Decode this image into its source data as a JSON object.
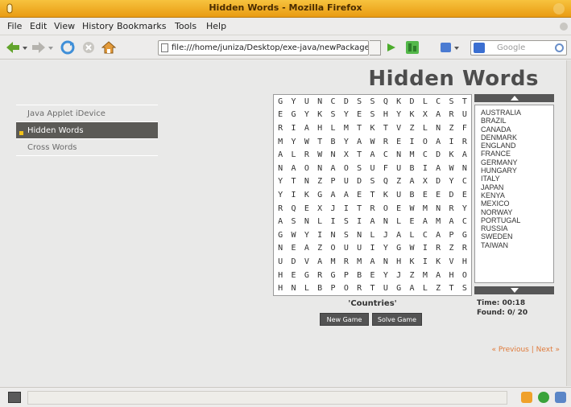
{
  "window": {
    "title": "Hidden Words - Mozilla Firefox"
  },
  "menu": [
    "File",
    "Edit",
    "View",
    "History",
    "Bookmarks",
    "Tools",
    "Help"
  ],
  "navbar": {
    "url": "file:///home/juniza/Desktop/exe-java/newPackage/hi…",
    "search_placeholder": "Google"
  },
  "app": {
    "title": "Hidden Words",
    "nav": [
      "Java Applet iDevice",
      "Hidden Words",
      "Cross Words"
    ],
    "grid": [
      [
        "G",
        "Y",
        "U",
        "N",
        "C",
        "D",
        "S",
        "S",
        "Q",
        "K",
        "D",
        "L",
        "C",
        "S",
        "T"
      ],
      [
        "E",
        "G",
        "Y",
        "K",
        "S",
        "Y",
        "E",
        "S",
        "H",
        "Y",
        "K",
        "X",
        "A",
        "R",
        "U"
      ],
      [
        "R",
        "I",
        "A",
        "H",
        "L",
        "M",
        "T",
        "K",
        "T",
        "V",
        "Z",
        "L",
        "N",
        "Z",
        "F"
      ],
      [
        "M",
        "Y",
        "W",
        "T",
        "B",
        "Y",
        "A",
        "W",
        "R",
        "E",
        "I",
        "O",
        "A",
        "I",
        "R"
      ],
      [
        "A",
        "L",
        "R",
        "W",
        "N",
        "X",
        "T",
        "A",
        "C",
        "N",
        "M",
        "C",
        "D",
        "K",
        "A"
      ],
      [
        "N",
        "A",
        "O",
        "N",
        "A",
        "O",
        "S",
        "U",
        "F",
        "U",
        "B",
        "I",
        "A",
        "W",
        "N"
      ],
      [
        "Y",
        "T",
        "N",
        "Z",
        "P",
        "U",
        "D",
        "S",
        "Q",
        "Z",
        "A",
        "X",
        "D",
        "Y",
        "C"
      ],
      [
        "Y",
        "I",
        "K",
        "G",
        "A",
        "A",
        "E",
        "T",
        "K",
        "U",
        "B",
        "E",
        "E",
        "D",
        "E"
      ],
      [
        "R",
        "Q",
        "E",
        "X",
        "J",
        "I",
        "T",
        "R",
        "O",
        "E",
        "W",
        "M",
        "N",
        "R",
        "Y"
      ],
      [
        "A",
        "S",
        "N",
        "L",
        "I",
        "S",
        "I",
        "A",
        "N",
        "L",
        "E",
        "A",
        "M",
        "A",
        "C"
      ],
      [
        "G",
        "W",
        "Y",
        "I",
        "N",
        "S",
        "N",
        "L",
        "J",
        "A",
        "L",
        "C",
        "A",
        "P",
        "G"
      ],
      [
        "N",
        "E",
        "A",
        "Z",
        "O",
        "U",
        "U",
        "I",
        "Y",
        "G",
        "W",
        "I",
        "R",
        "Z",
        "R"
      ],
      [
        "U",
        "D",
        "V",
        "A",
        "M",
        "R",
        "M",
        "A",
        "N",
        "H",
        "K",
        "I",
        "K",
        "V",
        "H"
      ],
      [
        "H",
        "E",
        "G",
        "R",
        "G",
        "P",
        "B",
        "E",
        "Y",
        "J",
        "Z",
        "M",
        "A",
        "H",
        "O"
      ],
      [
        "H",
        "N",
        "L",
        "B",
        "P",
        "O",
        "R",
        "T",
        "U",
        "G",
        "A",
        "L",
        "Z",
        "T",
        "S"
      ]
    ],
    "category": "'Countries'",
    "buttons": {
      "new_game": "New Game",
      "solve_game": "Solve Game"
    },
    "words": [
      "AUSTRALIA",
      "BRAZIL",
      "CANADA",
      "DENMARK",
      "ENGLAND",
      "FRANCE",
      "GERMANY",
      "HUNGARY",
      "ITALY",
      "JAPAN",
      "KENYA",
      "MEXICO",
      "NORWAY",
      "PORTUGAL",
      "RUSSIA",
      "SWEDEN",
      "TAIWAN"
    ],
    "time_label": "Time: 00:18",
    "found_label": "Found: 0/ 20",
    "pager": {
      "previous": "« Previous",
      "separator": "|",
      "next": "Next »"
    }
  },
  "colors": {
    "titlebar": "#f0ae25",
    "accent": "#f2c21b",
    "link": "#e07a3a"
  }
}
